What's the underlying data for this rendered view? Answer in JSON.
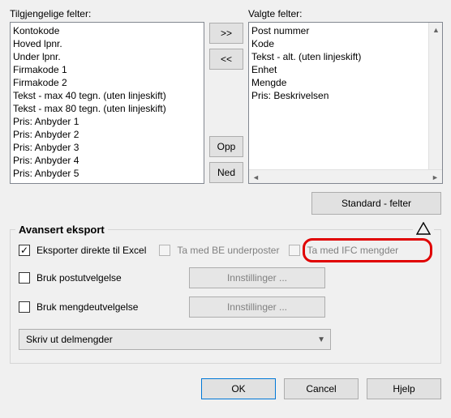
{
  "labels": {
    "available": "Tilgjengelige felter:",
    "selected": "Valgte felter:"
  },
  "available_items": [
    "Kontokode",
    "Hoved lpnr.",
    "Under lpnr.",
    "Firmakode 1",
    "Firmakode 2",
    "Tekst - max 40 tegn. (uten linjeskift)",
    "Tekst - max 80 tegn. (uten linjeskift)",
    "Pris: Anbyder 1",
    "Pris: Anbyder 2",
    "Pris: Anbyder 3",
    "Pris: Anbyder 4",
    "Pris: Anbyder 5"
  ],
  "selected_items": [
    "Post nummer",
    "Kode",
    "Tekst - alt. (uten linjeskift)",
    "Enhet",
    "Mengde",
    "Pris: Beskrivelsen"
  ],
  "buttons": {
    "add": ">>",
    "remove": "<<",
    "up": "Opp",
    "down": "Ned",
    "standard": "Standard - felter",
    "settings": "Innstillinger ...",
    "ok": "OK",
    "cancel": "Cancel",
    "help": "Hjelp"
  },
  "group": {
    "title": "Avansert eksport",
    "export_excel": "Eksporter direkte til Excel",
    "be_subitems": "Ta med BE underposter",
    "ifc_quantities": "Ta med IFC mengder",
    "post_selection": "Bruk postutvelgelse",
    "qty_selection": "Bruk mengdeutvelgelse",
    "dropdown_value": "Skriv ut delmengder"
  }
}
